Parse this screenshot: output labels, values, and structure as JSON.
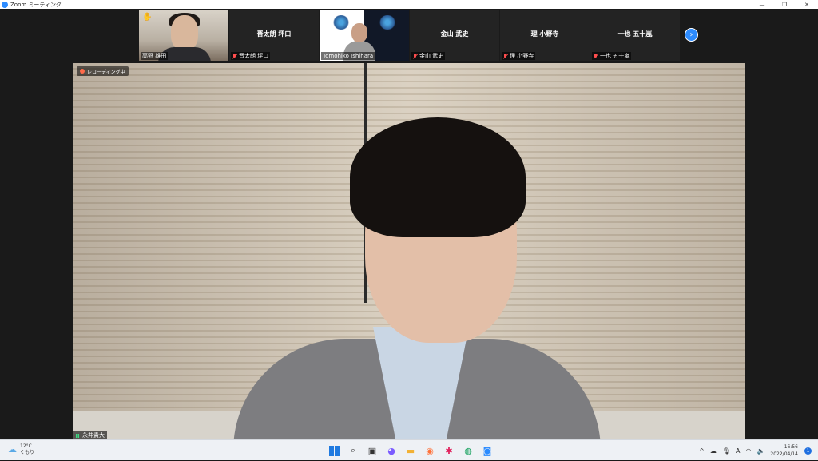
{
  "window": {
    "title": "Zoom ミーティング",
    "controls": [
      "—",
      "❐",
      "✕"
    ]
  },
  "participants": [
    {
      "name": "高野 雄田",
      "video": true,
      "hand_raised": true,
      "muted": false,
      "hand_icon": "✋"
    },
    {
      "name": "晋太朗 坪口",
      "video": false,
      "muted": true
    },
    {
      "name": "Tomohiko Ishihara",
      "video": true,
      "muted": false
    },
    {
      "name": "金山 武史",
      "video": false,
      "muted": true
    },
    {
      "name": "理 小野寺",
      "video": false,
      "muted": true
    },
    {
      "name": "一也 五十嵐",
      "video": false,
      "muted": true
    }
  ],
  "gallery_next_icon": "›",
  "recording": {
    "label": "レコーディング中"
  },
  "active_speaker": {
    "name": "永井貴大"
  },
  "taskbar": {
    "weather": {
      "temp": "12°C",
      "condition": "くもり",
      "icon": "☁"
    },
    "apps": [
      {
        "name": "start",
        "glyph": ""
      },
      {
        "name": "search",
        "glyph": "⌕"
      },
      {
        "name": "task-view",
        "glyph": "▣"
      },
      {
        "name": "chat",
        "glyph": "◕"
      },
      {
        "name": "file-explorer",
        "glyph": "▬"
      },
      {
        "name": "firefox",
        "glyph": "◉"
      },
      {
        "name": "slack",
        "glyph": "✱"
      },
      {
        "name": "browser",
        "glyph": "◍"
      },
      {
        "name": "zoom",
        "glyph": "◙"
      }
    ],
    "tray": {
      "chevron": "^",
      "cloud": "☁",
      "mic": "🎙",
      "ime": "A",
      "wifi": "◠",
      "volume": "🔈"
    },
    "clock": {
      "time": "16:56",
      "date": "2022/04/14"
    },
    "notifications": "1"
  },
  "colors": {
    "accent": "#2d8cff",
    "muted_red": "#ff4d4d",
    "taskbar_bg": "#eef1f5"
  }
}
